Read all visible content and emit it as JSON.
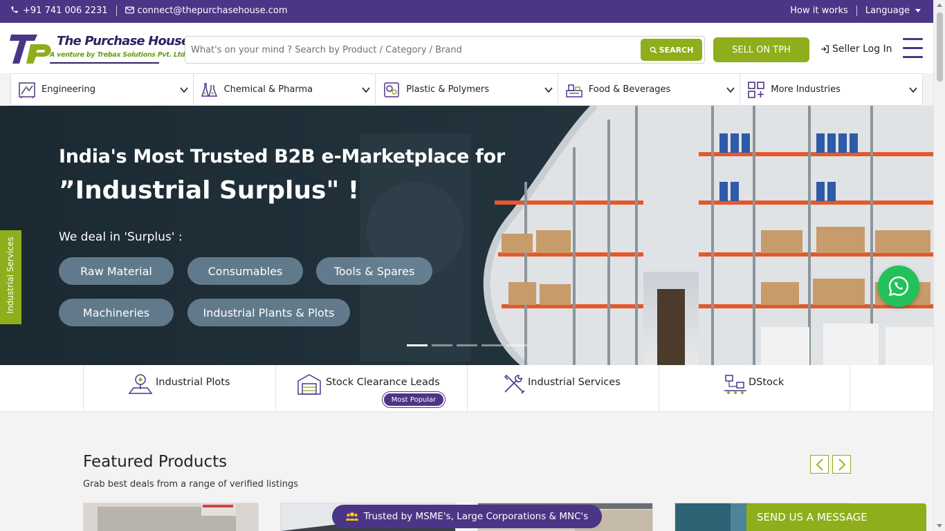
{
  "topbar": {
    "phone": "+91 741 006 2231",
    "email": "connect@thepurchasehouse.com",
    "how_it_works": "How it works",
    "language": "Language"
  },
  "header": {
    "logo_title": "The Purchase House",
    "logo_subtitle": "A venture by Trebax Solutions Pvt. Ltd.",
    "search_placeholder": "What's on your mind ? Search by Product / Category / Brand",
    "search_button": "SEARCH",
    "sell_button": "SELL ON TPH",
    "seller_login": "Seller Log In"
  },
  "categories": [
    {
      "label": "Engineering",
      "icon": "engineering-icon"
    },
    {
      "label": "Chemical & Pharma",
      "icon": "chemical-icon"
    },
    {
      "label": "Plastic & Polymers",
      "icon": "plastic-icon"
    },
    {
      "label": "Food & Beverages",
      "icon": "food-icon"
    },
    {
      "label": "More Industries",
      "icon": "grid-plus-icon"
    }
  ],
  "hero": {
    "headline": "India's Most Trusted B2B e-Marketplace for",
    "headline2": "”Industrial Surplus\" !",
    "deal_label": "We deal in 'Surplus' :",
    "pills": [
      "Raw Material",
      "Consumables",
      "Tools & Spares",
      "Machineries",
      "Industrial Plants & Plots"
    ],
    "slide_count": 5,
    "active_slide": 1
  },
  "side_tab": "Industrial Services",
  "services": [
    {
      "label": "Industrial Plots",
      "icon": "plot-icon"
    },
    {
      "label": "Stock Clearance Leads",
      "icon": "warehouse-icon",
      "badge": "Most Popular"
    },
    {
      "label": "Industrial Services",
      "icon": "tools-icon"
    },
    {
      "label": "DStock",
      "icon": "conveyor-icon"
    }
  ],
  "featured": {
    "title": "Featured Products",
    "subtitle": "Grab best deals from a range of verified listings"
  },
  "trusted_banner": "Trusted by MSME's, Large Corporations & MNC's",
  "send_message": "SEND US A MESSAGE",
  "colors": {
    "brand_purple": "#4b3586",
    "brand_green": "#8fae1b",
    "whatsapp_green": "#23c15b"
  }
}
